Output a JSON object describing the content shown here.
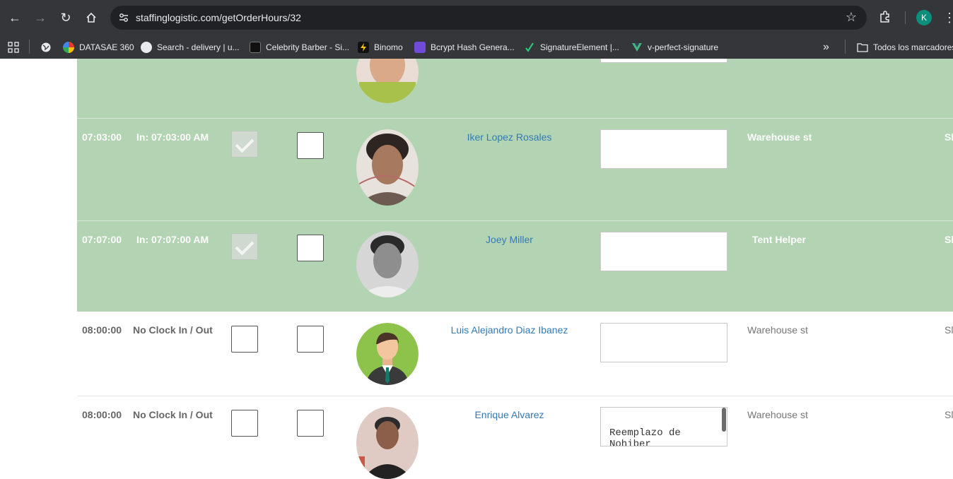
{
  "browser": {
    "url": "staffinglogistic.com/getOrderHours/32",
    "profile_initial": "K",
    "bookmarks": [
      {
        "label": "DATASAE 360",
        "color": "#e33b2e"
      },
      {
        "label": "Search - delivery | u...",
        "color": "#dcdcdc"
      },
      {
        "label": "Celebrity Barber - Si...",
        "color": "#1b1b1b"
      },
      {
        "label": "Binomo",
        "color": "#f4c20d"
      },
      {
        "label": "Bcrypt Hash Genera...",
        "color": "#6f4bd8"
      },
      {
        "label": "SignatureElement |...",
        "color": "#1aa36b"
      },
      {
        "label": "v-perfect-signature",
        "color": "#41b883"
      }
    ],
    "all_bookmarks_label": "Todos los marcadores"
  },
  "rows": [
    {
      "time": "07:03:00",
      "status": "In: 07:03:00 AM",
      "name": "Iker Lopez Rosales",
      "note": "",
      "location": "Warehouse st",
      "trail": "Sl"
    },
    {
      "time": "07:07:00",
      "status": "In: 07:07:00 AM",
      "name": "Joey Miller",
      "note": "",
      "location": "Tent Helper",
      "trail": "Sl"
    },
    {
      "time": "08:00:00",
      "status": "No Clock In / Out",
      "name": "Luis Alejandro Diaz Ibanez",
      "note": "",
      "location": "Warehouse st",
      "trail": "Sl"
    },
    {
      "time": "08:00:00",
      "status": "No Clock In / Out",
      "name": "Enrique Alvarez",
      "note": "Reemplazo de Nohiber",
      "location": "Warehouse st",
      "trail": "Sl"
    }
  ],
  "colors": {
    "active_row": "#b2d4b2",
    "link": "#337ab7"
  }
}
